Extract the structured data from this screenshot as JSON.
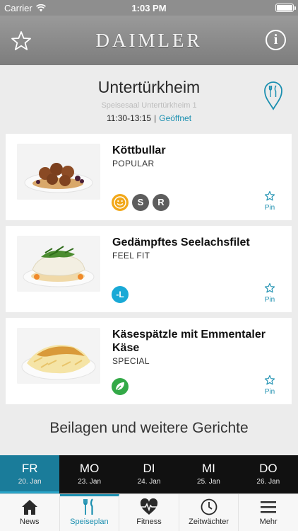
{
  "status_bar": {
    "carrier": "Carrier",
    "time": "1:03 PM"
  },
  "nav": {
    "brand": "DAIMLER"
  },
  "location": {
    "name": "Untertürkheim",
    "venue": "Speisesaal Untertürkheim 1",
    "hours": "11:30-13:15",
    "separator": "|",
    "status": "Geöffnet"
  },
  "menu": [
    {
      "dish": "Köttbullar",
      "category": "POPULAR",
      "badges": [
        "smiley",
        "S",
        "R"
      ],
      "pin_label": "Pin"
    },
    {
      "dish": "Gedämpftes Seelachsfilet",
      "category": "FEEL FIT",
      "badges": [
        "-L"
      ],
      "pin_label": "Pin"
    },
    {
      "dish": "Käsespätzle mit Emmentaler Käse",
      "category": "SPECIAL",
      "badges": [
        "leaf"
      ],
      "pin_label": "Pin"
    }
  ],
  "section_title": "Beilagen und weitere Gerichte",
  "days": [
    {
      "name": "FR",
      "date": "20. Jan",
      "active": true
    },
    {
      "name": "MO",
      "date": "23. Jan"
    },
    {
      "name": "DI",
      "date": "24. Jan"
    },
    {
      "name": "MI",
      "date": "25. Jan"
    },
    {
      "name": "DO",
      "date": "26. Jan"
    }
  ],
  "tabs": [
    {
      "label": "News",
      "icon": "home-icon"
    },
    {
      "label": "Speiseplan",
      "icon": "fork-knife-icon",
      "active": true
    },
    {
      "label": "Fitness",
      "icon": "heart-pulse-icon"
    },
    {
      "label": "Zeitwächter",
      "icon": "clock-icon"
    },
    {
      "label": "Mehr",
      "icon": "menu-icon"
    }
  ],
  "colors": {
    "accent": "#1b8fb0",
    "active_day": "#1a7c9a",
    "nav_bg": "#8e8e8e"
  }
}
